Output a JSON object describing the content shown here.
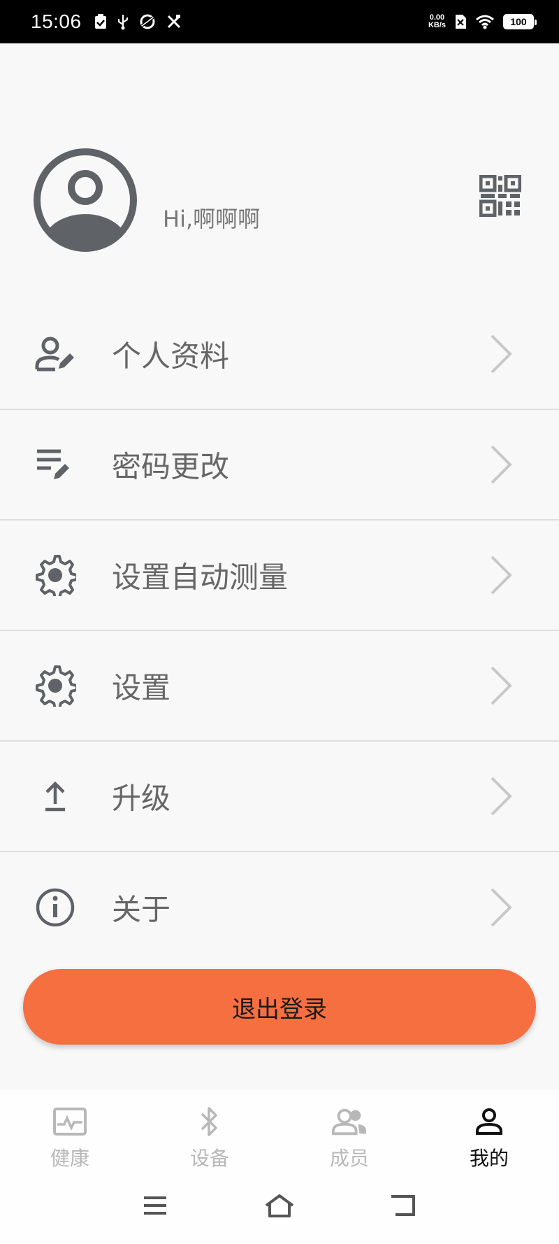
{
  "status_bar": {
    "time": "15:06",
    "net_speed_value": "0.00",
    "net_speed_unit": "KB/s",
    "battery": "100"
  },
  "profile": {
    "greeting": "Hi,啊啊啊"
  },
  "menu": {
    "items": [
      {
        "label": "个人资料",
        "icon": "user-edit-icon"
      },
      {
        "label": "密码更改",
        "icon": "list-edit-icon"
      },
      {
        "label": "设置自动测量",
        "icon": "gear-icon"
      },
      {
        "label": "设置",
        "icon": "gear-icon"
      },
      {
        "label": "升级",
        "icon": "upload-icon"
      },
      {
        "label": "关于",
        "icon": "info-icon"
      }
    ]
  },
  "logout": {
    "label": "退出登录"
  },
  "bottom_nav": {
    "items": [
      {
        "label": "健康",
        "icon": "health-monitor-icon",
        "active": false
      },
      {
        "label": "设备",
        "icon": "bluetooth-icon",
        "active": false
      },
      {
        "label": "成员",
        "icon": "members-icon",
        "active": false
      },
      {
        "label": "我的",
        "icon": "person-icon",
        "active": true
      }
    ]
  },
  "colors": {
    "accent": "#f56f40",
    "icon_gray": "#5f6368",
    "text_gray": "#666666",
    "inactive_nav": "#b8b8b8",
    "active_nav": "#111111"
  }
}
